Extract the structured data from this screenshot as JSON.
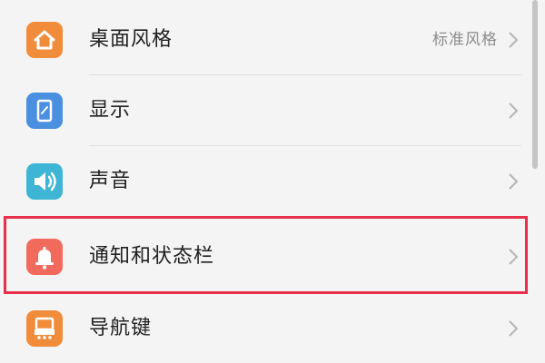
{
  "settings": {
    "items": [
      {
        "label": "桌面风格",
        "value": "标准风格",
        "icon": "home-icon",
        "color": "#f08c3a"
      },
      {
        "label": "显示",
        "value": "",
        "icon": "display-icon",
        "color": "#4a8fe0"
      },
      {
        "label": "声音",
        "value": "",
        "icon": "speaker-icon",
        "color": "#3fb5d6"
      },
      {
        "label": "通知和状态栏",
        "value": "",
        "icon": "bell-icon",
        "color": "#f26a5c"
      },
      {
        "label": "导航键",
        "value": "",
        "icon": "navigation-icon",
        "color": "#f08c3a"
      }
    ],
    "highlighted_item": "通知和状态栏",
    "highlight_color": "#e8304a"
  }
}
